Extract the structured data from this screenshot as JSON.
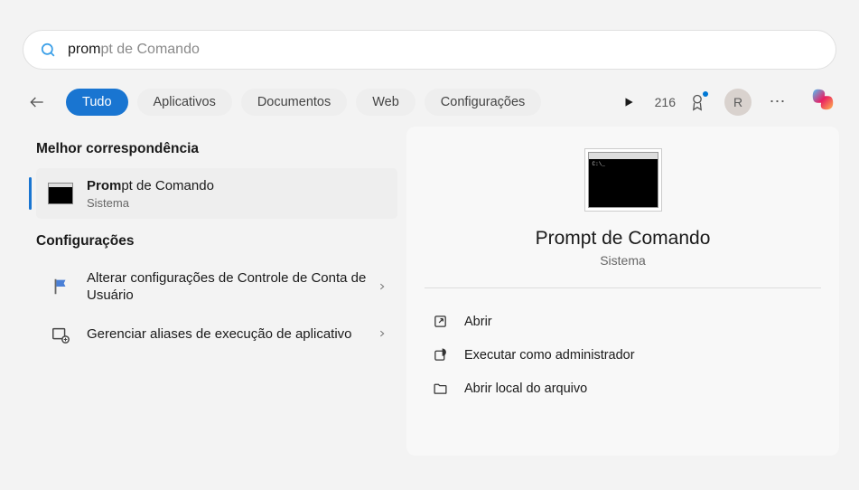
{
  "search": {
    "typed": "prom",
    "suggestion": "pt de Comando"
  },
  "filters": {
    "tabs": [
      {
        "label": "Tudo",
        "active": true
      },
      {
        "label": "Aplicativos",
        "active": false
      },
      {
        "label": "Documentos",
        "active": false
      },
      {
        "label": "Web",
        "active": false
      },
      {
        "label": "Configurações",
        "active": false
      }
    ],
    "points": "216",
    "avatar_initial": "R"
  },
  "sections": {
    "best_match_header": "Melhor correspondência",
    "settings_header": "Configurações"
  },
  "best_match": {
    "title_bold": "Prom",
    "title_rest": "pt de Comando",
    "subtitle": "Sistema"
  },
  "settings_items": [
    {
      "label": "Alterar configurações de Controle de Conta de Usuário"
    },
    {
      "label": "Gerenciar aliases de execução de aplicativo"
    }
  ],
  "detail": {
    "title": "Prompt de Comando",
    "subtitle": "Sistema",
    "actions": [
      {
        "label": "Abrir",
        "icon": "open"
      },
      {
        "label": "Executar como administrador",
        "icon": "admin"
      },
      {
        "label": "Abrir local do arquivo",
        "icon": "folder"
      }
    ]
  }
}
